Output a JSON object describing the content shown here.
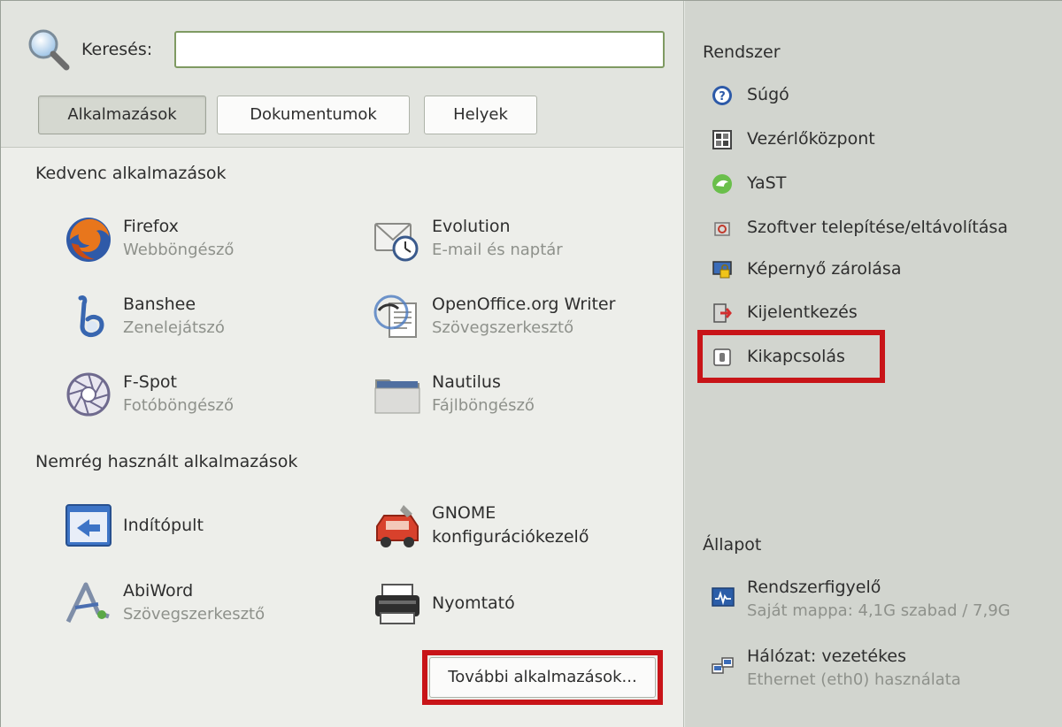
{
  "search": {
    "label": "Keresés:",
    "value": ""
  },
  "tabs": [
    {
      "label": "Alkalmazások",
      "active": true
    },
    {
      "label": "Dokumentumok",
      "active": false
    },
    {
      "label": "Helyek",
      "active": false
    }
  ],
  "favorites": {
    "title": "Kedvenc alkalmazások",
    "items": [
      {
        "name": "Firefox",
        "desc": "Webböngésző",
        "icon": "firefox-icon"
      },
      {
        "name": "Evolution",
        "desc": "E-mail és naptár",
        "icon": "evolution-icon"
      },
      {
        "name": "Banshee",
        "desc": "Zenelejátszó",
        "icon": "banshee-icon"
      },
      {
        "name": "OpenOffice.org Writer",
        "desc": "Szövegszerkesztő",
        "icon": "writer-icon"
      },
      {
        "name": "F-Spot",
        "desc": "Fotóböngésző",
        "icon": "fspot-icon"
      },
      {
        "name": "Nautilus",
        "desc": "Fájlböngésző",
        "icon": "folder-icon"
      }
    ]
  },
  "recent": {
    "title": "Nemrég használt alkalmazások",
    "items": [
      {
        "name": "Indítópult",
        "desc": "",
        "icon": "launcher-icon"
      },
      {
        "name": "GNOME",
        "name2": "konfigurációkezelő",
        "desc": "",
        "icon": "gconf-icon"
      },
      {
        "name": "AbiWord",
        "desc": "Szövegszerkesztő",
        "icon": "abiword-icon"
      },
      {
        "name": "Nyomtató",
        "desc": "",
        "icon": "printer-icon"
      }
    ]
  },
  "more_button": "További alkalmazások...",
  "system": {
    "title": "Rendszer",
    "items": [
      {
        "label": "Súgó",
        "icon": "help-icon"
      },
      {
        "label": "Vezérlőközpont",
        "icon": "control-center-icon"
      },
      {
        "label": "YaST",
        "icon": "yast-icon"
      },
      {
        "label": "Szoftver telepítése/eltávolítása",
        "icon": "software-icon"
      },
      {
        "label": "Képernyő zárolása",
        "icon": "lock-screen-icon"
      },
      {
        "label": "Kijelentkezés",
        "icon": "logout-icon"
      },
      {
        "label": "Kikapcsolás",
        "icon": "shutdown-icon"
      }
    ]
  },
  "status": {
    "title": "Állapot",
    "items": [
      {
        "label": "Rendszerfigyelő",
        "sub": "Saját mappa: 4,1G szabad / 7,9G",
        "icon": "system-monitor-icon"
      },
      {
        "label": "Hálózat: vezetékes",
        "sub": "Ethernet (eth0) használata",
        "icon": "network-icon"
      }
    ]
  },
  "colors": {
    "highlight": "#c81418",
    "search_border": "#7f9a62"
  }
}
